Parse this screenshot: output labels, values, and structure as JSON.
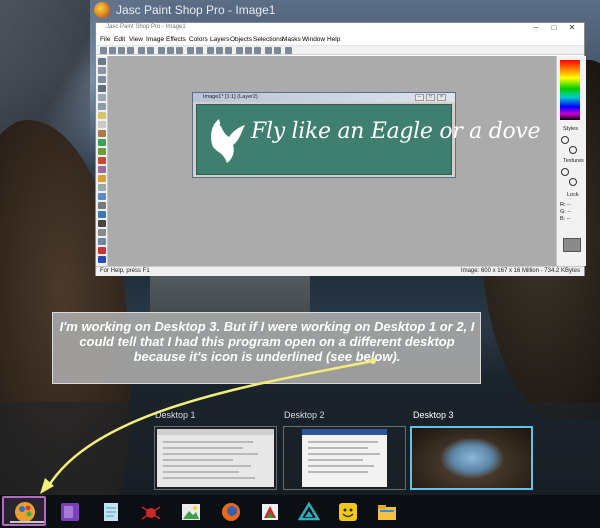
{
  "app": {
    "title": "Jasc Paint Shop Pro - Image1",
    "inner_title": "Jasc Paint Shop Pro - Image1"
  },
  "menu": [
    "File",
    "Edit",
    "View",
    "Image",
    "Effects",
    "Colors",
    "Layers",
    "Objects",
    "Selections",
    "Masks",
    "Window",
    "Help"
  ],
  "image_window": {
    "title": "Image1* [1:1] (Layer2)",
    "canvas_text": "Fly like an Eagle or a dove",
    "canvas_color": "#3f7f6f"
  },
  "palette": {
    "styles_label": "Styles",
    "textures_label": "Textures",
    "lock_label": "Lock",
    "rgb": [
      "R: --",
      "G: --",
      "B: --"
    ]
  },
  "status": {
    "left": "For Help, press F1",
    "right": "Image: 600 x 167 x 16 Million - 734.2 KBytes"
  },
  "callout": {
    "text": "I'm working on Desktop 3. But if I were working on Desktop 1 or 2, I could tell that I had this program open on a different desktop because it's icon is underlined (see below).",
    "arrow_color": "#f2ee7a"
  },
  "taskview": {
    "desktops": [
      {
        "label": "Desktop 1",
        "active": false
      },
      {
        "label": "Desktop 2",
        "active": false
      },
      {
        "label": "Desktop 3",
        "active": true
      }
    ],
    "active_border_color": "#63c1ee"
  },
  "taskbar": {
    "icons": [
      "paint-shop-pro-icon",
      "onenote-icon",
      "notepad-icon",
      "spider-solitaire-icon",
      "photo-viewer-icon",
      "firefox-icon",
      "sticky-notes-icon",
      "feedly-icon",
      "smiley-icon",
      "file-explorer-icon"
    ],
    "highlight_color": "#b06bc0"
  }
}
